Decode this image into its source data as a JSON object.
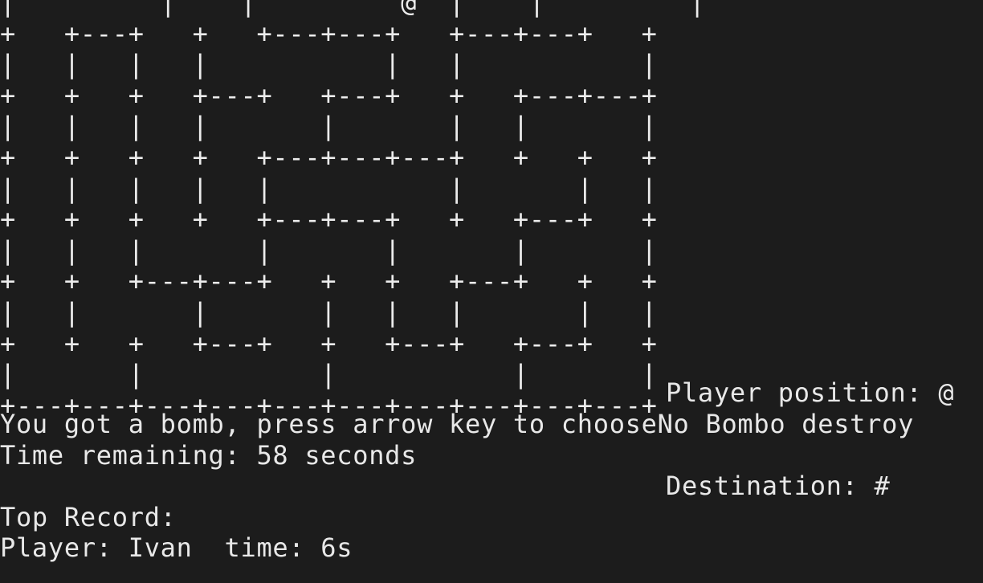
{
  "maze": {
    "rows": [
      "|         |    |         @  |    |         |",
      "+   +---+   +   +---+---+   +---+---+   +",
      "|   |   |   |           |   |           |",
      "+   +   +   +---+   +---+   +   +---+---+",
      "|   |   |   |       |       |   |       |",
      "+   +   +   +   +---+---+---+   +   +   +",
      "|   |   |   |   |           |       |   |",
      "+   +   +   +   +---+---+   +   +---+   +",
      "|   |   |       |       |       |       |",
      "+   +   +---+---+   +   +   +---+   +   +",
      "|   |       |       |   |   |       |   |",
      "+   +   +   +---+   +   +---+   +---+   +",
      "|       |           |           |       |",
      "+---+---+---+---+---+---+---+---+---+---+"
    ]
  },
  "legend": {
    "player_position": "Player position: @",
    "destination": "Destination: #"
  },
  "status": {
    "bomb_message": "You got a bomb, press arrow key to chooseNo Bombo destroy",
    "time_remaining": "Time remaining: 58 seconds",
    "top_record_title": "Top Record:",
    "top_record_entry": "Player: Ivan  time: 6s"
  },
  "colors": {
    "background": "#1c1c1c",
    "text": "#e8e8e8"
  }
}
